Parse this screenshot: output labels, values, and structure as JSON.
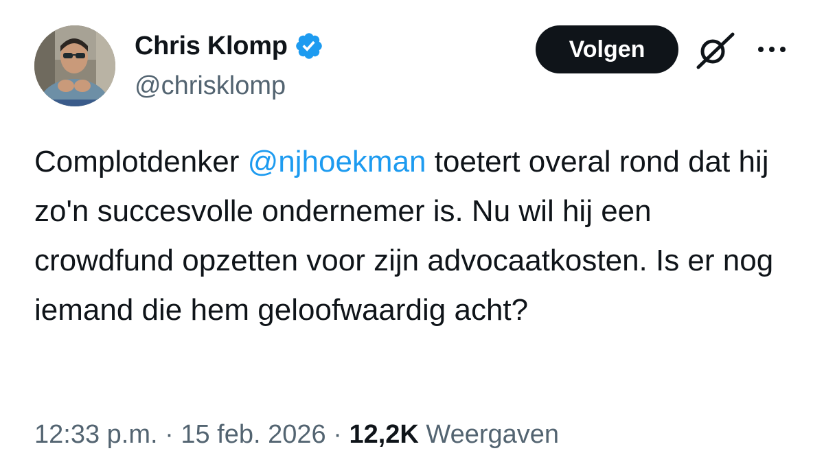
{
  "author": {
    "display_name": "Chris Klomp",
    "handle": "@chrisklomp",
    "verified": true
  },
  "actions": {
    "follow_label": "Volgen",
    "grok_icon": "grok-icon",
    "more_icon": "more-icon"
  },
  "tweet": {
    "text_before": "Complotdenker ",
    "mention": "@njhoekman",
    "text_after": " toetert overal rond dat hij zo'n succesvolle ondernemer is. Nu wil hij een crowdfund opzetten voor zijn advocaatkosten. Is er nog iemand die hem geloofwaardig acht?"
  },
  "meta": {
    "time": "12:33 p.m.",
    "separator": "·",
    "date": "15 feb. 2026",
    "views_count": "12,2K",
    "views_label": "Weergaven"
  },
  "colors": {
    "text": "#0f1419",
    "secondary": "#536471",
    "accent": "#1d9bf0",
    "button_bg": "#0f1419",
    "button_text": "#ffffff"
  }
}
